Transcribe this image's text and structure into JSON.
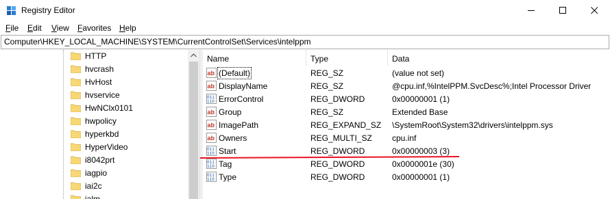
{
  "window": {
    "title": "Registry Editor"
  },
  "menu": [
    "File",
    "Edit",
    "View",
    "Favorites",
    "Help"
  ],
  "address": "Computer\\HKEY_LOCAL_MACHINE\\SYSTEM\\CurrentControlSet\\Services\\intelppm",
  "tree": {
    "items": [
      "HTTP",
      "hvcrash",
      "HvHost",
      "hvservice",
      "HwNClx0101",
      "hwpolicy",
      "hyperkbd",
      "HyperVideo",
      "i8042prt",
      "iagpio",
      "iai2c",
      "ialm"
    ]
  },
  "list": {
    "columns": {
      "name": "Name",
      "type": "Type",
      "data": "Data"
    },
    "rows": [
      {
        "name": "(Default)",
        "type": "REG_SZ",
        "data": "(value not set)",
        "icon": "string-value-icon"
      },
      {
        "name": "DisplayName",
        "type": "REG_SZ",
        "data": "@cpu.inf,%IntelPPM.SvcDesc%;Intel Processor Driver",
        "icon": "string-value-icon"
      },
      {
        "name": "ErrorControl",
        "type": "REG_DWORD",
        "data": "0x00000001 (1)",
        "icon": "binary-value-icon"
      },
      {
        "name": "Group",
        "type": "REG_SZ",
        "data": "Extended Base",
        "icon": "string-value-icon"
      },
      {
        "name": "ImagePath",
        "type": "REG_EXPAND_SZ",
        "data": "\\SystemRoot\\System32\\drivers\\intelppm.sys",
        "icon": "string-value-icon"
      },
      {
        "name": "Owners",
        "type": "REG_MULTI_SZ",
        "data": "cpu.inf",
        "icon": "string-value-icon"
      },
      {
        "name": "Start",
        "type": "REG_DWORD",
        "data": "0x00000003 (3)",
        "icon": "binary-value-icon"
      },
      {
        "name": "Tag",
        "type": "REG_DWORD",
        "data": "0x0000001e (30)",
        "icon": "binary-value-icon"
      },
      {
        "name": "Type",
        "type": "REG_DWORD",
        "data": "0x00000001 (1)",
        "icon": "binary-value-icon"
      }
    ]
  },
  "colors": {
    "annotation": "#e81123",
    "folder": "#f8d775",
    "scrollbar": "#cdcdcd"
  }
}
